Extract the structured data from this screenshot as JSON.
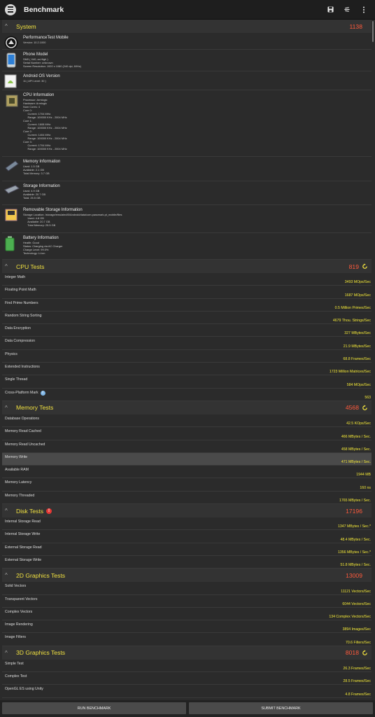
{
  "appbar": {
    "title": "Benchmark"
  },
  "sections": {
    "system": {
      "title": "System",
      "score": "1138"
    },
    "cpu": {
      "title": "CPU Tests",
      "score": "819"
    },
    "memory": {
      "title": "Memory Tests",
      "score": "4568"
    },
    "disk": {
      "title": "Disk Tests",
      "score": "17196"
    },
    "g2d": {
      "title": "2D Graphics Tests",
      "score": "13009"
    },
    "g3d": {
      "title": "3D Graphics Tests",
      "score": "8018"
    }
  },
  "system": {
    "perftest": {
      "title": "PerformanceTest Mobile",
      "lines": [
        "Version: 10.2.1000"
      ]
    },
    "phone": {
      "title": "Phone Model",
      "lines": [
        "SM0 ( X40, ar-High )",
        "Serial Number: unknown",
        "Screen Resolution: 1920 x 1080 (240 dpi, 60Hz)"
      ]
    },
    "android": {
      "title": "Android OS Version",
      "lines": [
        "11 ( API Level: 30 )"
      ]
    },
    "cpu": {
      "title": "CPU Information",
      "lines": [
        "Processor: Armlogic",
        "Hardware: Armlogic",
        "Num Cores: 4",
        "Core 0:",
        "      Current: 1704 MHz",
        "      Range: 100000 KHz - 2004 MHz",
        "Core 1:",
        "      Current: 1608 MHz",
        "      Range: 100000 KHz - 2004 MHz",
        "Core 2:",
        "      Current: 1404 MHz",
        "      Range: 100000 KHz - 2004 MHz",
        "Core 3:",
        "      Current: 1704 MHz",
        "      Range: 100000 KHz - 2004 MHz"
      ]
    },
    "memory": {
      "title": "Memory Information",
      "lines": [
        "Used: 1.5 GB",
        "Available: 2.1 GB",
        "Total Memory: 3.7 GB"
      ]
    },
    "storage": {
      "title": "Storage Information",
      "lines": [
        "Used: 4.9 GB",
        "Available: 20.7 GB",
        "Total: 25.5 GB"
      ]
    },
    "removable": {
      "title": "Removable Storage Information",
      "lines": [
        "Storage Location: /storage/emulated/0/Android/data/com.passmark.pt_mobile/files",
        "      Used: 4.8 GB",
        "      Available: 20.7 GB",
        "      Total Memory: 25.5 GB"
      ]
    },
    "battery": {
      "title": "Battery Information",
      "lines": [
        "Health: Good",
        "Status: Charging via AC Charger",
        "Charge Level: 99.0%",
        "Technology: Li-ion"
      ]
    }
  },
  "cpu_tests": [
    {
      "name": "Integer Math",
      "value": "3493 MOps/Sec"
    },
    {
      "name": "Floating Point Math",
      "value": "1687 MOps/Sec"
    },
    {
      "name": "Find Prime Numbers",
      "value": "0.5 Million Primes/Sec"
    },
    {
      "name": "Random String Sorting",
      "value": "4679 Thou. Strings/Sec"
    },
    {
      "name": "Data Encryption",
      "value": "327 MBytes/Sec"
    },
    {
      "name": "Data Compression",
      "value": "21.9 MBytes/Sec"
    },
    {
      "name": "Physics",
      "value": "68.8 Frames/Sec"
    },
    {
      "name": "Extended Instructions",
      "value": "1723 Million Matrices/Sec"
    },
    {
      "name": "Single Thread",
      "value": "584 MOps/Sec"
    },
    {
      "name": "Cross-Platform Mark",
      "value": "563"
    }
  ],
  "memory_tests": [
    {
      "name": "Database Operations",
      "value": "42.5 KOps/Sec"
    },
    {
      "name": "Memory Read Cached",
      "value": "466 MBytes / Sec."
    },
    {
      "name": "Memory Read Uncached",
      "value": "458 MBytes / Sec."
    },
    {
      "name": "Memory Write",
      "value": "471 MBytes / Sec."
    },
    {
      "name": "Available RAM",
      "value": "1944 MB"
    },
    {
      "name": "Memory Latency",
      "value": "160 ns"
    },
    {
      "name": "Memory Threaded",
      "value": "1765 MBytes / Sec."
    }
  ],
  "disk_tests": [
    {
      "name": "Internal Storage Read",
      "value": "1347 MBytes / Sec.*"
    },
    {
      "name": "Internal Storage Write",
      "value": "48.4 MBytes / Sec."
    },
    {
      "name": "External Storage Read",
      "value": "1356 MBytes / Sec.*"
    },
    {
      "name": "External Storage Write",
      "value": "51.8 MBytes / Sec."
    }
  ],
  "g2d_tests": [
    {
      "name": "Solid Vectors",
      "value": "11121 Vectors/Sec"
    },
    {
      "name": "Transparent Vectors",
      "value": "6044 Vectors/Sec"
    },
    {
      "name": "Complex Vectors",
      "value": "134 Complex Vectors/Sec"
    },
    {
      "name": "Image Rendering",
      "value": "3894 Images/Sec"
    },
    {
      "name": "Image Filters",
      "value": "70.6 Filters/Sec"
    }
  ],
  "g3d_tests": [
    {
      "name": "Simple Test",
      "value": "26.3 Frames/Sec"
    },
    {
      "name": "Complex Test",
      "value": "28.5 Frames/Sec"
    },
    {
      "name": "OpenGL ES using Unity",
      "value": "4.8 Frames/Sec"
    }
  ],
  "buttons": {
    "run": "RUN BENCHMARK",
    "submit": "SUBMIT BENCHMARK"
  },
  "colors": {
    "accent_yellow": "#f0e040",
    "score_red": "#ff5a3c",
    "value_yellow": "#f3e838",
    "background": "#2b2b2b"
  }
}
